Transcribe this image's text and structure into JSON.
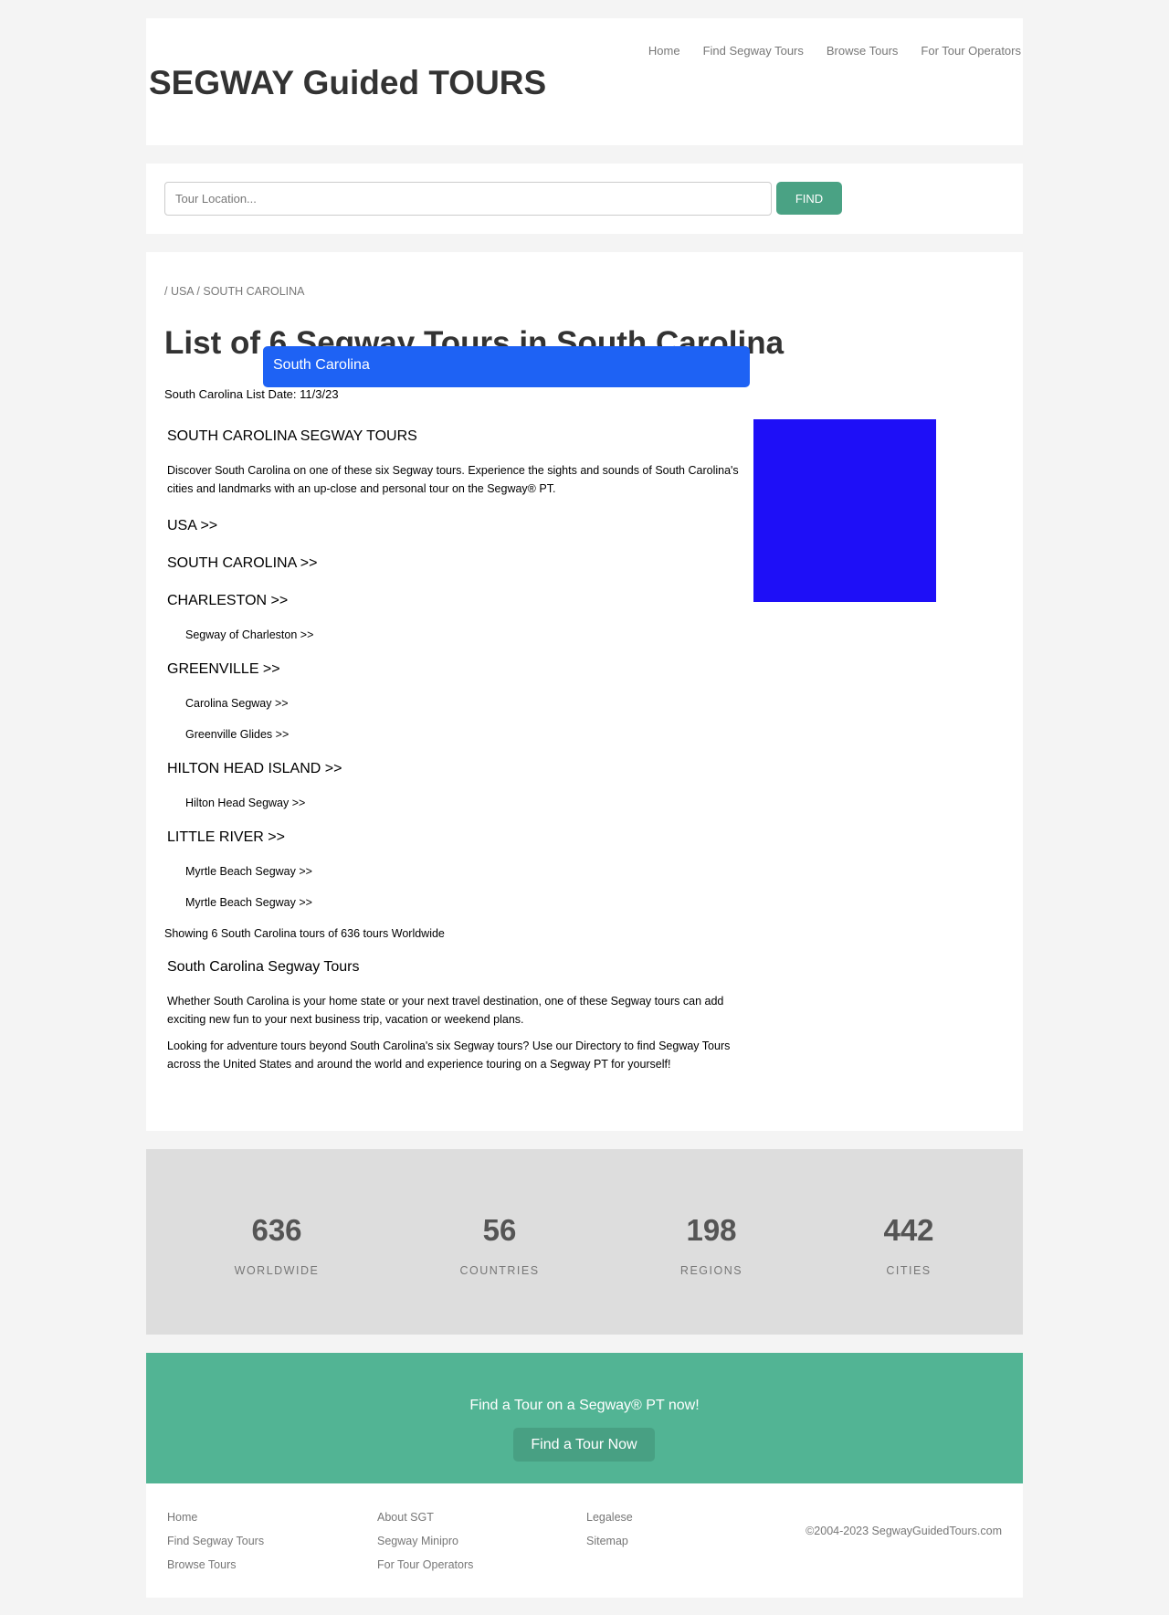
{
  "header": {
    "site_title": "SEGWAY Guided TOURS",
    "nav": [
      "Home",
      "Find Segway Tours",
      "Browse Tours",
      "For Tour Operators"
    ]
  },
  "search": {
    "placeholder": "Tour Location...",
    "button_label": "FIND"
  },
  "main": {
    "breadcrumb": "/ USA / SOUTH CAROLINA",
    "title": "List of 6 Segway Tours in South Carolina",
    "location_pill": "South Carolina",
    "list_date": "South Carolina List Date: 11/3/23",
    "image_color": "#1e0ff7",
    "section_heading": "SOUTH CAROLINA SEGWAY TOURS",
    "intro": "Discover South Carolina on one of these six Segway tours. Experience the sights and sounds of South Carolina's cities and landmarks with an up-close and personal tour on the Segway® PT.",
    "country_link": "USA >>",
    "state_link": "SOUTH CAROLINA >>",
    "cities": [
      {
        "name": "CHARLESTON >>",
        "tours": [
          "Segway of Charleston >>"
        ]
      },
      {
        "name": "GREENVILLE >>",
        "tours": [
          "Carolina Segway >>",
          "Greenville Glides >>"
        ]
      },
      {
        "name": "HILTON HEAD ISLAND >>",
        "tours": [
          "Hilton Head Segway >>"
        ]
      },
      {
        "name": "LITTLE RIVER >>",
        "tours": [
          "Myrtle Beach Segway >>",
          "Myrtle Beach Segway >>"
        ]
      }
    ],
    "showing": "Showing 6 South Carolina tours of 636 tours Worldwide",
    "subheading": "South Carolina Segway Tours",
    "para1": "Whether South Carolina is your home state or your next travel destination, one of these Segway tours can add exciting new fun to your next business trip, vacation or weekend plans.",
    "para2": "Looking for adventure tours beyond South Carolina's six Segway tours? Use our Directory to find Segway Tours across the United States and around the world and experience touring on a Segway PT for yourself!"
  },
  "stats": [
    {
      "value": "636",
      "label": "WORLDWIDE"
    },
    {
      "value": "56",
      "label": "COUNTRIES"
    },
    {
      "value": "198",
      "label": "REGIONS"
    },
    {
      "value": "442",
      "label": "CITIES"
    }
  ],
  "cta": {
    "text": "Find a Tour on a Segway® PT now!",
    "button_label": "Find a Tour Now"
  },
  "footer": {
    "col1": [
      "Home",
      "Find Segway Tours",
      "Browse Tours"
    ],
    "col2": [
      "About SGT",
      "Segway Minipro",
      "For Tour Operators"
    ],
    "col3": [
      "Legalese",
      "Sitemap"
    ],
    "copyright": "©2004-2023 SegwayGuidedTours.com"
  },
  "colors": {
    "accent_green": "#4aa284",
    "cta_green": "#52b494",
    "pill_blue": "#1e62f4"
  }
}
